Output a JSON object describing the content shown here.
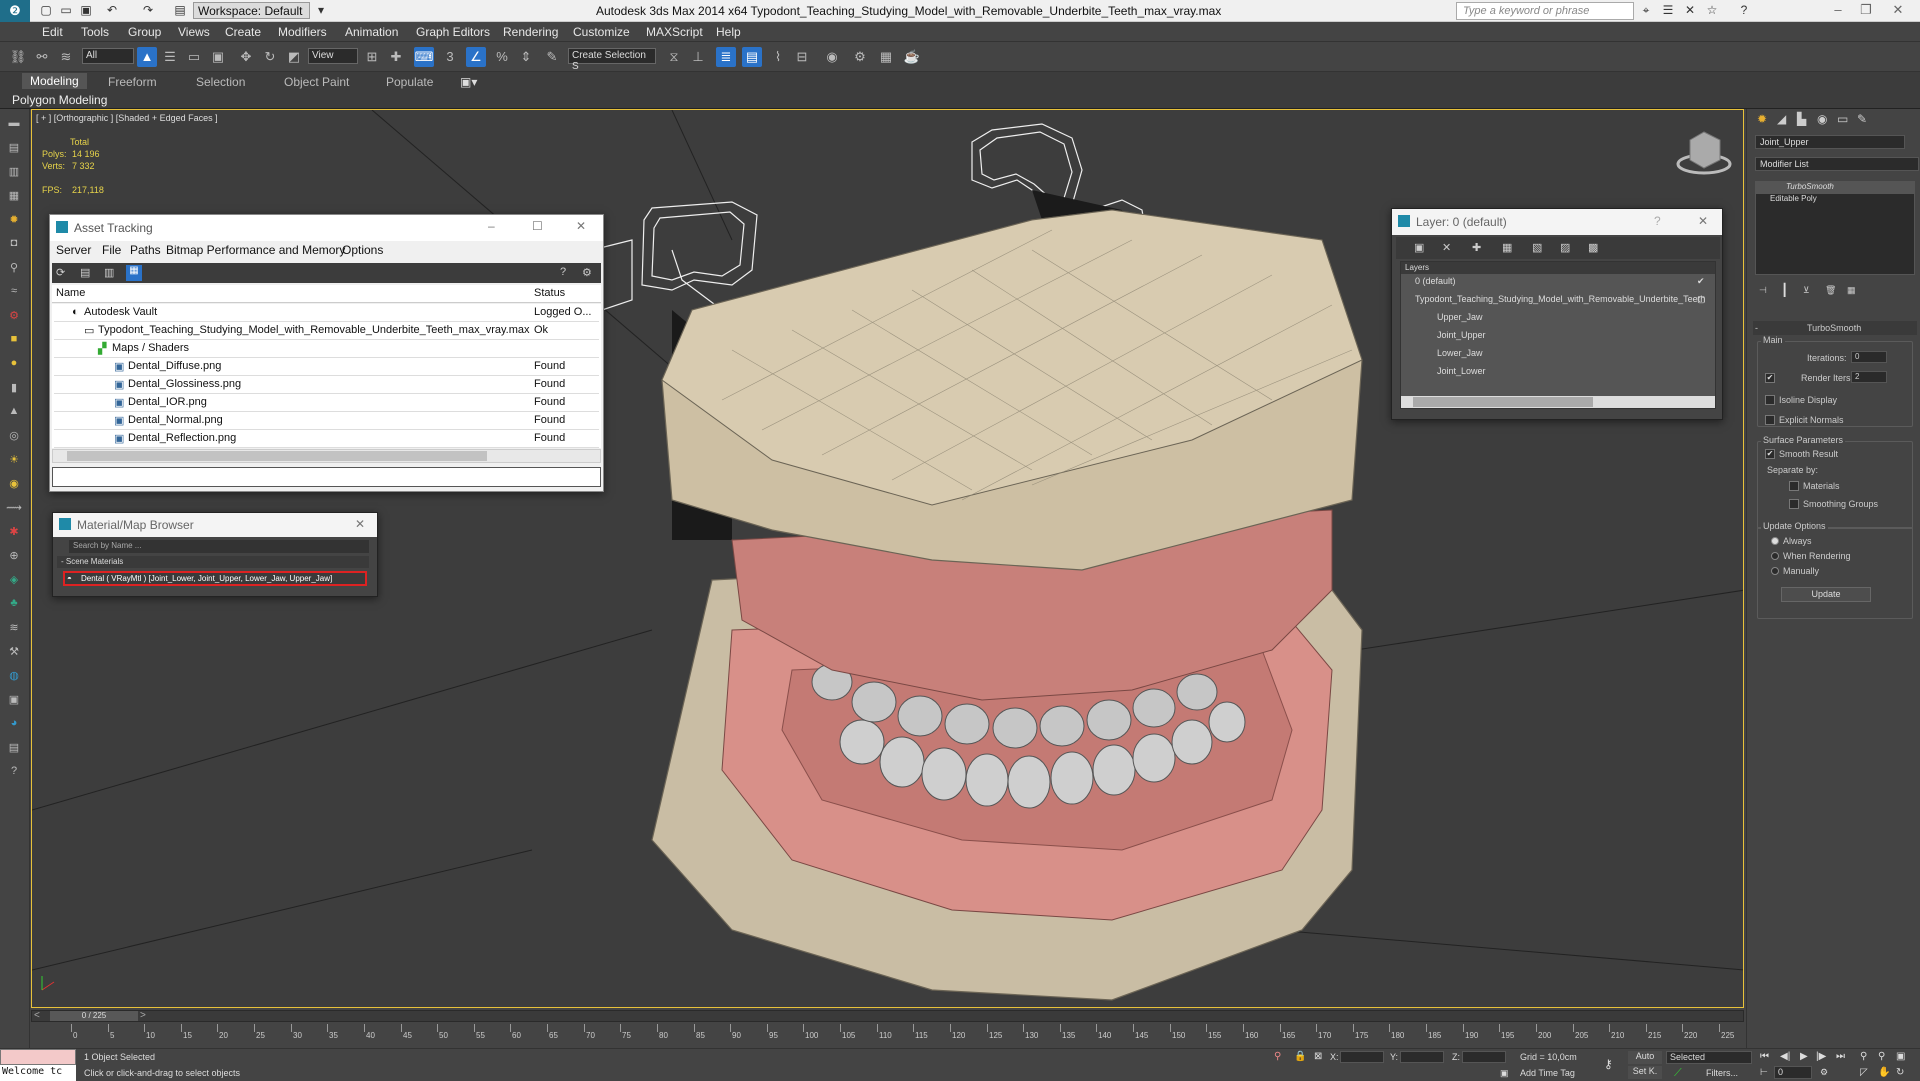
{
  "titlebar": {
    "workspace": "Workspace: Default",
    "title": "Autodesk 3ds Max  2014 x64     Typodont_Teaching_Studying_Model_with_Removable_Underbite_Teeth_max_vray.max",
    "search_placeholder": "Type a keyword or phrase"
  },
  "menu": [
    "Edit",
    "Tools",
    "Group",
    "Views",
    "Create",
    "Modifiers",
    "Animation",
    "Graph Editors",
    "Rendering",
    "Customize",
    "MAXScript",
    "Help"
  ],
  "toolbar": {
    "selection_filter": "All",
    "ref_coord": "View",
    "named_selection": "Create Selection S"
  },
  "ribbon": {
    "tabs": [
      "Modeling",
      "Freeform",
      "Selection",
      "Object Paint",
      "Populate"
    ],
    "active_tab": "Modeling",
    "sub_label": "Polygon Modeling"
  },
  "viewport": {
    "label": "[ + ] [Orthographic ] [Shaded + Edged Faces ]",
    "stats_total": "Total",
    "polys_label": "Polys:",
    "polys_value": "14 196",
    "verts_label": "Verts:",
    "verts_value": "7 332",
    "fps_label": "FPS:",
    "fps_value": "217,118"
  },
  "asset_tracking": {
    "title": "Asset Tracking",
    "menu": [
      "Server",
      "File",
      "Paths",
      "Bitmap Performance and Memory",
      "Options"
    ],
    "col_name": "Name",
    "col_status": "Status",
    "rows": [
      {
        "name": "Autodesk Vault",
        "status": "Logged O..."
      },
      {
        "name": "Typodont_Teaching_Studying_Model_with_Removable_Underbite_Teeth_max_vray.max",
        "status": "Ok"
      },
      {
        "name": "Maps / Shaders",
        "status": ""
      },
      {
        "name": "Dental_Diffuse.png",
        "status": "Found"
      },
      {
        "name": "Dental_Glossiness.png",
        "status": "Found"
      },
      {
        "name": "Dental_IOR.png",
        "status": "Found"
      },
      {
        "name": "Dental_Normal.png",
        "status": "Found"
      },
      {
        "name": "Dental_Reflection.png",
        "status": "Found"
      }
    ]
  },
  "material_browser": {
    "title": "Material/Map Browser",
    "search_placeholder": "Search by Name ...",
    "section": "- Scene Materials",
    "item": "Dental  ( VRayMtl ) [Joint_Lower, Joint_Upper, Lower_Jaw, Upper_Jaw]"
  },
  "layer_window": {
    "title": "Layer: 0 (default)",
    "header": "Layers",
    "items": [
      "0 (default)",
      "Typodont_Teaching_Studying_Model_with_Removable_Underbite_Teeth",
      "Upper_Jaw",
      "Joint_Upper",
      "Lower_Jaw",
      "Joint_Lower"
    ]
  },
  "command_panel": {
    "object_name": "Joint_Upper",
    "modifier_list": "Modifier List",
    "stack": [
      "TurboSmooth",
      "Editable Poly"
    ],
    "rollout_title": "TurboSmooth",
    "main_label": "Main",
    "iterations_label": "Iterations:",
    "iterations_value": "0",
    "render_iters_label": "Render Iters:",
    "render_iters_value": "2",
    "isoline": "Isoline Display",
    "explicit_normals": "Explicit Normals",
    "surface_params": "Surface Parameters",
    "smooth_result": "Smooth Result",
    "separate_by": "Separate by:",
    "materials": "Materials",
    "smoothing_groups": "Smoothing Groups",
    "update_options": "Update Options",
    "always": "Always",
    "when_rendering": "When Rendering",
    "manually": "Manually",
    "update_button": "Update"
  },
  "timeline": {
    "frame_counter": "0 / 225",
    "ticks": [
      "0",
      "5",
      "10",
      "15",
      "20",
      "25",
      "30",
      "35",
      "40",
      "45",
      "50",
      "55",
      "60",
      "65",
      "70",
      "75",
      "80",
      "85",
      "90",
      "95",
      "100",
      "105",
      "110",
      "115",
      "120",
      "125",
      "130",
      "135",
      "140",
      "145",
      "150",
      "155",
      "160",
      "165",
      "170",
      "175",
      "180",
      "185",
      "190",
      "195",
      "200",
      "205",
      "210",
      "215",
      "220",
      "225"
    ]
  },
  "status": {
    "maxscript": "Welcome tc",
    "selected": "1 Object Selected",
    "prompt": "Click or click-and-drag to select objects",
    "x_label": "X:",
    "y_label": "Y:",
    "z_label": "Z:",
    "grid": "Grid = 10,0cm",
    "add_time_tag": "Add Time Tag",
    "auto": "Auto",
    "set_key": "Set K.",
    "selected_dropdown": "Selected",
    "filters": "Filters...",
    "frame": "0"
  }
}
